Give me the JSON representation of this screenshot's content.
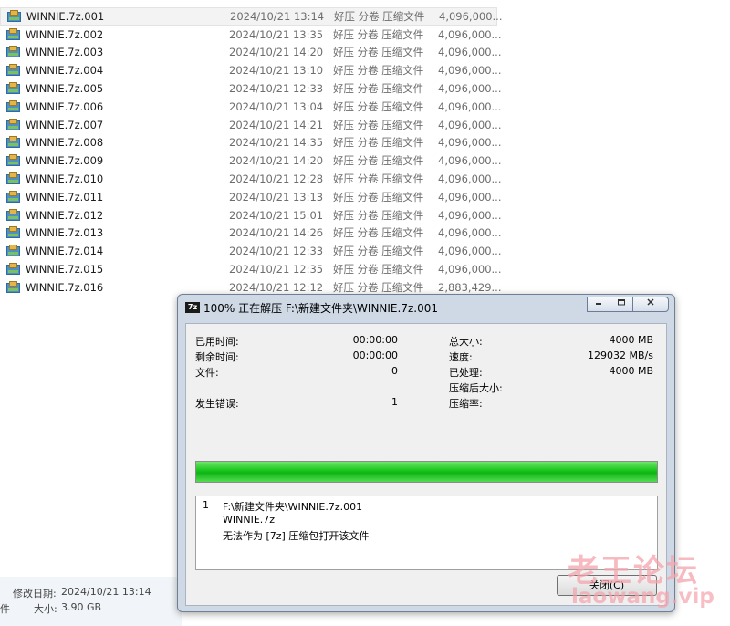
{
  "files": [
    {
      "name": "WINNIE.7z.001",
      "date": "2024/10/21 13:14",
      "type": "好压 分卷 压缩文件",
      "size": "4,096,000..."
    },
    {
      "name": "WINNIE.7z.002",
      "date": "2024/10/21 13:35",
      "type": "好压 分卷 压缩文件",
      "size": "4,096,000..."
    },
    {
      "name": "WINNIE.7z.003",
      "date": "2024/10/21 14:20",
      "type": "好压 分卷 压缩文件",
      "size": "4,096,000..."
    },
    {
      "name": "WINNIE.7z.004",
      "date": "2024/10/21 13:10",
      "type": "好压 分卷 压缩文件",
      "size": "4,096,000..."
    },
    {
      "name": "WINNIE.7z.005",
      "date": "2024/10/21 12:33",
      "type": "好压 分卷 压缩文件",
      "size": "4,096,000..."
    },
    {
      "name": "WINNIE.7z.006",
      "date": "2024/10/21 13:04",
      "type": "好压 分卷 压缩文件",
      "size": "4,096,000..."
    },
    {
      "name": "WINNIE.7z.007",
      "date": "2024/10/21 14:21",
      "type": "好压 分卷 压缩文件",
      "size": "4,096,000..."
    },
    {
      "name": "WINNIE.7z.008",
      "date": "2024/10/21 14:35",
      "type": "好压 分卷 压缩文件",
      "size": "4,096,000..."
    },
    {
      "name": "WINNIE.7z.009",
      "date": "2024/10/21 14:20",
      "type": "好压 分卷 压缩文件",
      "size": "4,096,000..."
    },
    {
      "name": "WINNIE.7z.010",
      "date": "2024/10/21 12:28",
      "type": "好压 分卷 压缩文件",
      "size": "4,096,000..."
    },
    {
      "name": "WINNIE.7z.011",
      "date": "2024/10/21 13:13",
      "type": "好压 分卷 压缩文件",
      "size": "4,096,000..."
    },
    {
      "name": "WINNIE.7z.012",
      "date": "2024/10/21 15:01",
      "type": "好压 分卷 压缩文件",
      "size": "4,096,000..."
    },
    {
      "name": "WINNIE.7z.013",
      "date": "2024/10/21 14:26",
      "type": "好压 分卷 压缩文件",
      "size": "4,096,000..."
    },
    {
      "name": "WINNIE.7z.014",
      "date": "2024/10/21 12:33",
      "type": "好压 分卷 压缩文件",
      "size": "4,096,000..."
    },
    {
      "name": "WINNIE.7z.015",
      "date": "2024/10/21 12:35",
      "type": "好压 分卷 压缩文件",
      "size": "4,096,000..."
    },
    {
      "name": "WINNIE.7z.016",
      "date": "2024/10/21 12:12",
      "type": "好压 分卷 压缩文件",
      "size": "2,883,429..."
    }
  ],
  "details": {
    "modified_label": "修改日期:",
    "modified_value": "2024/10/21 13:14",
    "type_fragment": "件",
    "size_label": "大小:",
    "size_value": "3.90 GB"
  },
  "dialog": {
    "app_icon": "7z",
    "title": "100% 正在解压 F:\\新建文件夹\\WINNIE.7z.001",
    "min_icon": "minimize-icon",
    "max_icon": "maximize-icon",
    "close_icon": "close-icon",
    "elapsed_label": "已用时间:",
    "elapsed_value": "00:00:00",
    "remaining_label": "剩余时间:",
    "remaining_value": "00:00:00",
    "files_label": "文件:",
    "files_value": "0",
    "errors_label": "发生错误:",
    "errors_value": "1",
    "total_size_label": "总大小:",
    "total_size_value": "4000 MB",
    "speed_label": "速度:",
    "speed_value": "129032 MB/s",
    "processed_label": "已处理:",
    "processed_value": "4000 MB",
    "compressed_size_label": "压缩后大小:",
    "ratio_label": "压缩率:",
    "progress_percent": 100,
    "message": {
      "index": "1",
      "path": "F:\\新建文件夹\\WINNIE.7z.001",
      "archive": "WINNIE.7z",
      "error": "无法作为 [7z] 压缩包打开该文件"
    },
    "close_button_label": "关闭(C)"
  },
  "watermark": {
    "cn": "老王论坛",
    "en": "laowang.vip"
  },
  "colors": {
    "progress_fill": "#16c41a",
    "dialog_frame": "#cfd9e6",
    "watermark": "#f4a4ac"
  }
}
